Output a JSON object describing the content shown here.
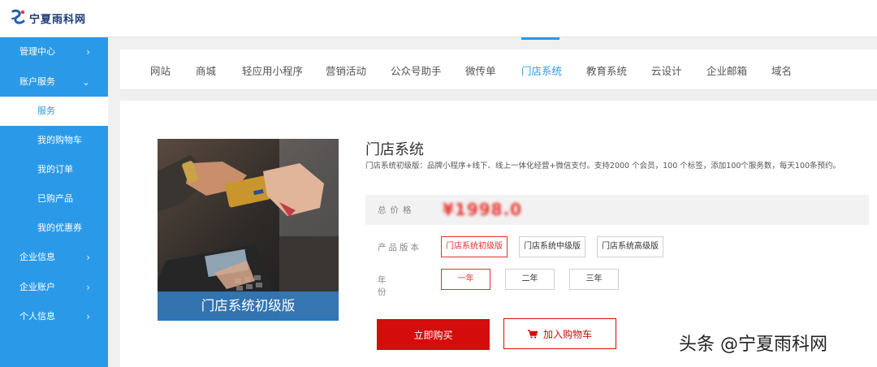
{
  "header": {
    "logo_text": "宁夏雨科网"
  },
  "sidebar": {
    "items": [
      {
        "label": "管理中心",
        "chevron": "›"
      },
      {
        "label": "账户服务",
        "chevron": "⌄"
      },
      {
        "label": "服务"
      },
      {
        "label": "我的购物车"
      },
      {
        "label": "我的订单"
      },
      {
        "label": "已购产品"
      },
      {
        "label": "我的优惠券"
      },
      {
        "label": "企业信息",
        "chevron": "›"
      },
      {
        "label": "企业账户",
        "chevron": "›"
      },
      {
        "label": "个人信息",
        "chevron": "›"
      }
    ]
  },
  "tabs": [
    "网站",
    "商城",
    "轻应用小程序",
    "营销活动",
    "公众号助手",
    "微传单",
    "门店系统",
    "教育系统",
    "云设计",
    "企业邮箱",
    "域名"
  ],
  "active_tab": "门店系统",
  "product": {
    "image_caption": "门店系统初级版",
    "title": "门店系统",
    "description": "门店系统初级版：品牌小程序+线下、线上一体化经营+微信支付。支持2000 个会员，100 个标签，添加100个服务数，每天100条预约。",
    "price_label": "总价格",
    "price_value": "¥1998.0",
    "version_label": "产品版本",
    "versions": [
      "门店系统初级版",
      "门店系统中级版",
      "门店系统高级版"
    ],
    "selected_version": "门店系统初级版",
    "year_label": "年份",
    "years": [
      "一年",
      "二年",
      "三年"
    ],
    "selected_year": "一年",
    "buy_label": "立即购买",
    "cart_label": "加入购物车"
  },
  "watermark": "头条 @宁夏雨科网",
  "colors": {
    "sidebar": "#2a9ae8",
    "accent_blue": "#2a9ae8",
    "brand_red": "#d40c0c"
  },
  "icons": {
    "cart": "cart-icon",
    "logo": "logo-icon"
  }
}
